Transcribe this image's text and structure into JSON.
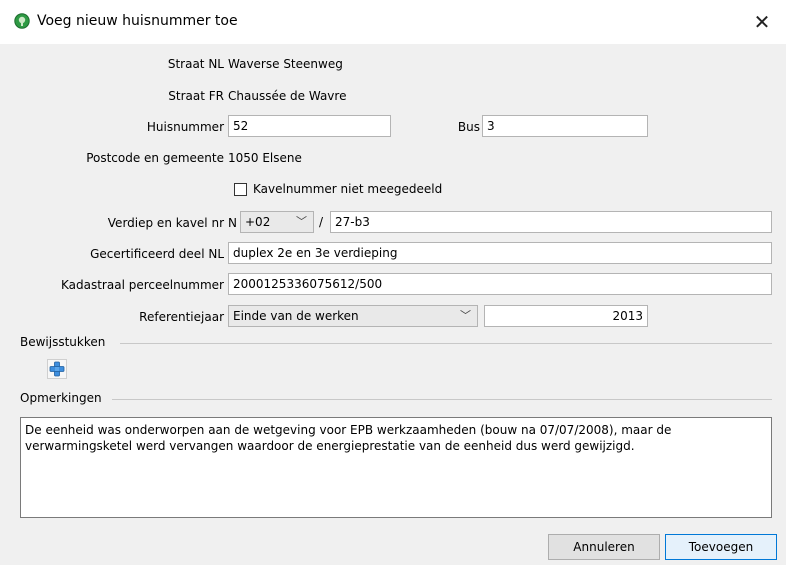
{
  "window": {
    "title": "Voeg nieuw huisnummer toe",
    "close_label": "✕"
  },
  "form": {
    "straat_nl": {
      "label": "Straat NL",
      "value": "Waverse Steenweg"
    },
    "straat_fr": {
      "label": "Straat FR",
      "value": "Chaussée de Wavre"
    },
    "huisnummer": {
      "label": "Huisnummer",
      "value": "52"
    },
    "bus": {
      "label": "Bus",
      "value": "3"
    },
    "postcode": {
      "label": "Postcode en gemeente",
      "value": "1050 Elsene"
    },
    "kavelnummer_checkbox": {
      "label": "Kavelnummer niet meegedeeld",
      "checked": false
    },
    "verdiep": {
      "label": "Verdiep en kavel nr",
      "prefix": "N",
      "floor_value": "+02",
      "separator": "/",
      "kavel_value": "27-b3"
    },
    "gecertificeerd": {
      "label": "Gecertificeerd deel NL",
      "value": "duplex 2e en 3e verdieping"
    },
    "kadastraal": {
      "label": "Kadastraal perceelnummer",
      "value": "2000125336075612/500"
    },
    "referentiejaar": {
      "label": "Referentiejaar",
      "select_value": "Einde van de werken",
      "year_value": "2013"
    }
  },
  "bewijsstukken": {
    "title": "Bewijsstukken"
  },
  "opmerkingen": {
    "title": "Opmerkingen",
    "text": "De eenheid was onderworpen aan de wetgeving voor EPB werkzaamheden (bouw na 07/07/2008), maar de\nverwarmingsketel werd vervangen waardoor de energieprestatie van de eenheid dus werd gewijzigd."
  },
  "buttons": {
    "cancel": "Annuleren",
    "add": "Toevoegen"
  }
}
